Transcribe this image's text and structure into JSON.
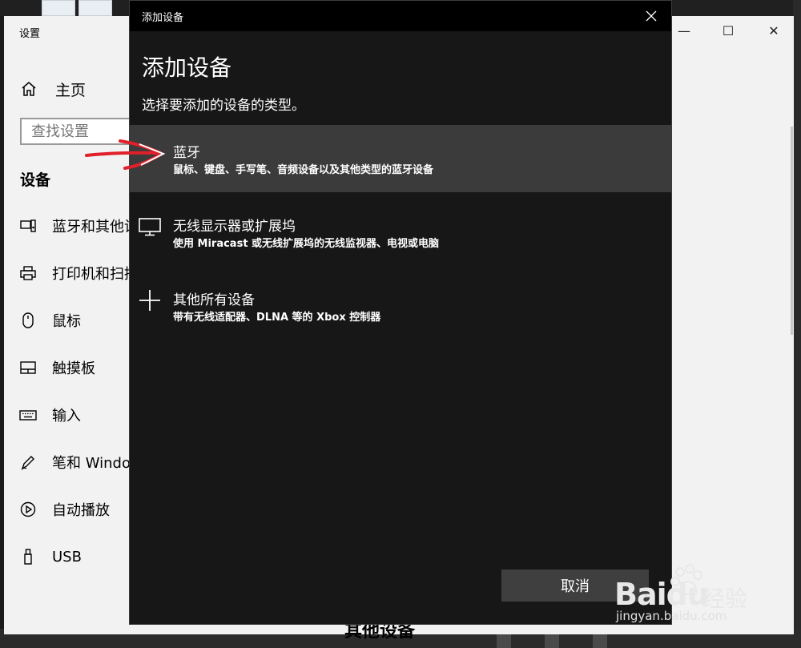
{
  "settings": {
    "title": "设置",
    "home_label": "主页",
    "search_placeholder": "查找设置",
    "section_title": "设备",
    "nav_items": [
      {
        "label": "蓝牙和其他设备",
        "icon": "keyboard-speaker-icon"
      },
      {
        "label": "打印机和扫描仪",
        "icon": "printer-icon"
      },
      {
        "label": "鼠标",
        "icon": "mouse-icon"
      },
      {
        "label": "触摸板",
        "icon": "touchpad-icon"
      },
      {
        "label": "输入",
        "icon": "keyboard-icon"
      },
      {
        "label": "笔和 Windows Ink",
        "icon": "pen-icon"
      },
      {
        "label": "自动播放",
        "icon": "autoplay-icon"
      },
      {
        "label": "USB",
        "icon": "usb-icon"
      }
    ],
    "bottom_heading": "其他设备"
  },
  "dialog": {
    "title": "添加设备",
    "heading": "添加设备",
    "subheading": "选择要添加的设备的类型。",
    "options": [
      {
        "title": "蓝牙",
        "description": "鼠标、键盘、手写笔、音频设备以及其他类型的蓝牙设备",
        "icon": "bluetooth-icon",
        "selected": true
      },
      {
        "title": "无线显示器或扩展坞",
        "description": "使用 Miracast 或无线扩展坞的无线监视器、电视或电脑",
        "icon": "monitor-icon",
        "selected": false
      },
      {
        "title": "其他所有设备",
        "description": "带有无线适配器、DLNA 等的 Xbox 控制器",
        "icon": "plus-icon",
        "selected": false
      }
    ],
    "cancel_label": "取消"
  },
  "watermark": {
    "brand": "Bai",
    "brand_suffix": "du",
    "jingyan": "经验",
    "site": "jingyan.baidu.com"
  },
  "colors": {
    "dialog_bg": "#171717",
    "selected_row": "#3b3b3b",
    "annotation_arrow": "#e0202a"
  }
}
